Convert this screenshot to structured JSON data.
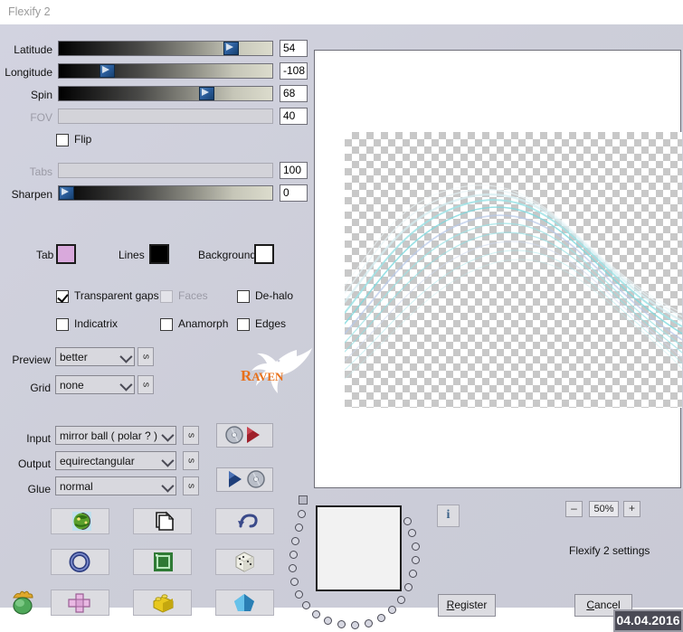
{
  "window": {
    "title": "Flexify 2"
  },
  "sliders": [
    {
      "label": "Latitude",
      "value": "54",
      "pct": 78,
      "disabled": false
    },
    {
      "label": "Longitude",
      "value": "-108",
      "pct": 20,
      "disabled": false
    },
    {
      "label": "Spin",
      "value": "68",
      "pct": 66,
      "disabled": false
    },
    {
      "label": "FOV",
      "value": "40",
      "pct": 0,
      "disabled": true
    },
    {
      "label": "Tabs",
      "value": "100",
      "pct": 0,
      "disabled": true
    },
    {
      "label": "Sharpen",
      "value": "0",
      "pct": 1,
      "disabled": false
    }
  ],
  "flip": {
    "label": "Flip",
    "checked": false
  },
  "swatches": [
    {
      "label": "Tab",
      "color": "#d9a9dc"
    },
    {
      "label": "Lines",
      "color": "#000000"
    },
    {
      "label": "Background",
      "color": "#ffffff"
    }
  ],
  "checkboxes": [
    {
      "label": "Transparent gaps",
      "checked": true,
      "disabled": false
    },
    {
      "label": "Faces",
      "checked": false,
      "disabled": true
    },
    {
      "label": "De-halo",
      "checked": false,
      "disabled": false
    },
    {
      "label": "Indicatrix",
      "checked": false,
      "disabled": false
    },
    {
      "label": "Anamorph",
      "checked": false,
      "disabled": false
    },
    {
      "label": "Edges",
      "checked": false,
      "disabled": false
    }
  ],
  "selects": [
    {
      "label": "Preview",
      "value": "better"
    },
    {
      "label": "Grid",
      "value": "none"
    },
    {
      "label": "Input",
      "value": "mirror ball   ( polar ? )"
    },
    {
      "label": "Output",
      "value": "equirectangular"
    },
    {
      "label": "Glue",
      "value": "normal"
    }
  ],
  "refresh_button_glyph": "s",
  "transfer_buttons": [
    {
      "name": "load-preset-button",
      "icon": "disc-to-arrow-icon"
    },
    {
      "name": "save-preset-button",
      "icon": "arrow-to-disc-icon"
    }
  ],
  "grid_buttons": [
    {
      "name": "globe-button",
      "icon": "globe-icon"
    },
    {
      "name": "pages-button",
      "icon": "pages-icon"
    },
    {
      "name": "undo-button",
      "icon": "undo-arrow-icon"
    },
    {
      "name": "torus-button",
      "icon": "torus-icon"
    },
    {
      "name": "frame-button",
      "icon": "green-frame-icon"
    },
    {
      "name": "dice-button",
      "icon": "dice-icon"
    },
    {
      "name": "cross-button",
      "icon": "pink-cross-icon"
    },
    {
      "name": "brick-button",
      "icon": "yellow-brick-icon"
    },
    {
      "name": "crystal-button",
      "icon": "blue-crystal-icon"
    }
  ],
  "corner_icon": {
    "name": "green-gem-icon"
  },
  "zoom": {
    "minus": "–",
    "value": "50%",
    "plus": "+"
  },
  "footer": {
    "settings_label": "Flexify 2 settings",
    "register_label": "Register",
    "register_accel": "R",
    "cancel_label": "Cancel",
    "cancel_accel": "C",
    "date": "04.04.2016",
    "info_glyph": "i"
  },
  "preview": {
    "alt": "equirectangular preview with transparent checkerboard and cyan wave curves"
  }
}
